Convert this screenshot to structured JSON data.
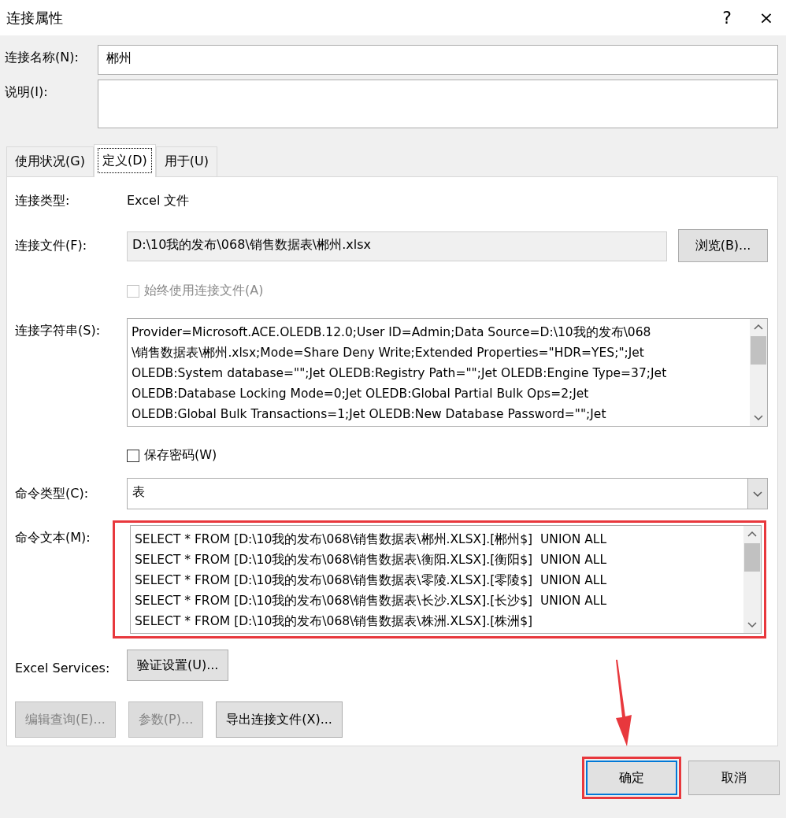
{
  "window": {
    "title": "连接属性",
    "help": "?",
    "close": "×"
  },
  "name_field": {
    "label": "连接名称(N):",
    "value": "郴州"
  },
  "description_field": {
    "label": "说明(I):"
  },
  "tabs": [
    {
      "label": "使用状况(G)",
      "selected": false
    },
    {
      "label": "定义(D)",
      "selected": true
    },
    {
      "label": "用于(U)",
      "selected": false
    }
  ],
  "connection_type": {
    "label": "连接类型:",
    "value": "Excel 文件"
  },
  "connection_file": {
    "label": "连接文件(F):",
    "value": "D:\\10我的发布\\068\\销售数据表\\郴州.xlsx",
    "browse_button": "浏览(B)..."
  },
  "always_use_file": {
    "label": "始终使用连接文件(A)",
    "checked": false,
    "disabled": true
  },
  "connection_string": {
    "label": "连接字符串(S):",
    "lines": [
      "Provider=Microsoft.ACE.OLEDB.12.0;User ID=Admin;Data Source=D:\\10我的发布\\068",
      "\\销售数据表\\郴州.xlsx;Mode=Share Deny Write;Extended Properties=\"HDR=YES;\";Jet",
      "OLEDB:System database=\"\";Jet OLEDB:Registry Path=\"\";Jet OLEDB:Engine Type=37;Jet",
      "OLEDB:Database Locking Mode=0;Jet OLEDB:Global Partial Bulk Ops=2;Jet",
      "OLEDB:Global Bulk Transactions=1;Jet OLEDB:New Database Password=\"\";Jet"
    ]
  },
  "save_password": {
    "label": "保存密码(W)",
    "checked": false,
    "disabled": false
  },
  "command_type": {
    "label": "命令类型(C):",
    "value": "表"
  },
  "command_text": {
    "label": "命令文本(M):",
    "highlighted": true,
    "lines": [
      "SELECT * FROM [D:\\10我的发布\\068\\销售数据表\\郴州.XLSX].[郴州$]  UNION ALL",
      "SELECT * FROM [D:\\10我的发布\\068\\销售数据表\\衡阳.XLSX].[衡阳$]  UNION ALL",
      "SELECT * FROM [D:\\10我的发布\\068\\销售数据表\\零陵.XLSX].[零陵$]  UNION ALL",
      "SELECT * FROM [D:\\10我的发布\\068\\销售数据表\\长沙.XLSX].[长沙$]  UNION ALL",
      "SELECT * FROM [D:\\10我的发布\\068\\销售数据表\\株洲.XLSX].[株洲$]"
    ]
  },
  "excel_services": {
    "label": "Excel Services:",
    "button": "验证设置(U)..."
  },
  "action_buttons": [
    {
      "label": "编辑查询(E)...",
      "disabled": true
    },
    {
      "label": "参数(P)...",
      "disabled": true
    },
    {
      "label": "导出连接文件(X)...",
      "disabled": false
    }
  ],
  "dialog_buttons": [
    {
      "label": "确定",
      "default": true,
      "highlighted": true
    },
    {
      "label": "取消",
      "default": false,
      "highlighted": false
    }
  ]
}
